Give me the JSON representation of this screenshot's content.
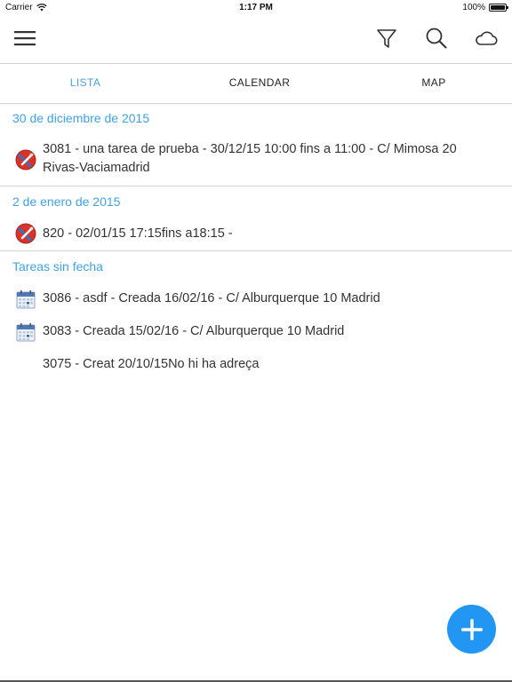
{
  "status_bar": {
    "carrier": "Carrier",
    "time": "1:17 PM",
    "battery": "100%"
  },
  "toolbar": {
    "menu_icon": "menu-icon",
    "filter_icon": "filter-icon",
    "search_icon": "search-icon",
    "cloud_icon": "cloud-icon"
  },
  "tabs": [
    {
      "label": "LISTA",
      "active": true
    },
    {
      "label": "CALENDAR",
      "active": false
    },
    {
      "label": "MAP",
      "active": false
    }
  ],
  "sections": [
    {
      "header": "30 de diciembre de 2015",
      "items": [
        {
          "icon": "repair-tools-icon",
          "text": "3081 - una tarea de prueba - 30/12/15 10:00 fins a 11:00 - C/ Mimosa 20 Rivas-Vaciamadrid"
        }
      ]
    },
    {
      "header": "2 de enero de 2015",
      "items": [
        {
          "icon": "repair-tools-icon",
          "text": "820 - 02/01/15 17:15fins a18:15 -"
        }
      ]
    },
    {
      "header": "Tareas sin fecha",
      "items": [
        {
          "icon": "calendar-icon",
          "text": "3086 - asdf - Creada 16/02/16 - C/ Alburquerque 10 Madrid"
        },
        {
          "icon": "calendar-icon",
          "text": "3083 - Creada 15/02/16 - C/ Alburquerque 10 Madrid"
        },
        {
          "icon": "",
          "text": "3075 - Creat 20/10/15No hi ha adreça"
        }
      ]
    }
  ],
  "fab": {
    "icon": "plus-icon"
  },
  "colors": {
    "accent": "#3fa3e6",
    "fab": "#2196f3",
    "repair_red": "#d9322a",
    "repair_blue": "#3f6fb5"
  }
}
